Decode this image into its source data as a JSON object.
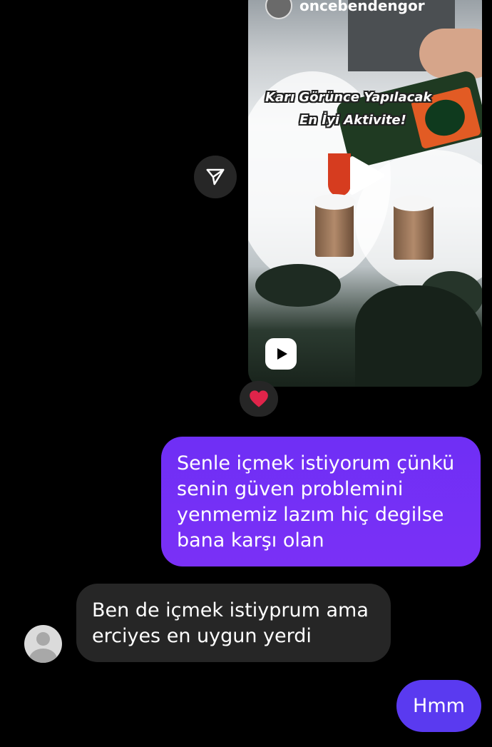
{
  "shared_reel": {
    "author": "oncebendengor",
    "caption_line1": "Karı Görünce Yapılacak",
    "caption_line2": "En İyi Aktivite!",
    "reel_icon": "reel-play-icon",
    "center_icon": "play-icon"
  },
  "share_button": {
    "icon": "send-icon"
  },
  "reaction": {
    "icon": "heart-icon",
    "color": "#e0244a"
  },
  "messages": [
    {
      "sender": "me",
      "text": "Senle içmek istiyorum çünkü senin güven problemini yenmemiz lazım hiç degilse bana karşı olan"
    },
    {
      "sender": "other",
      "text": "Ben de içmek istiyprum ama erciyes en uygun yerdi"
    },
    {
      "sender": "me",
      "text": "Hmm"
    }
  ],
  "colors": {
    "background": "#000000",
    "outgoing_bubble": "#7b2ff7",
    "outgoing_bubble_short": "#5a3af0",
    "incoming_bubble": "#262626"
  }
}
